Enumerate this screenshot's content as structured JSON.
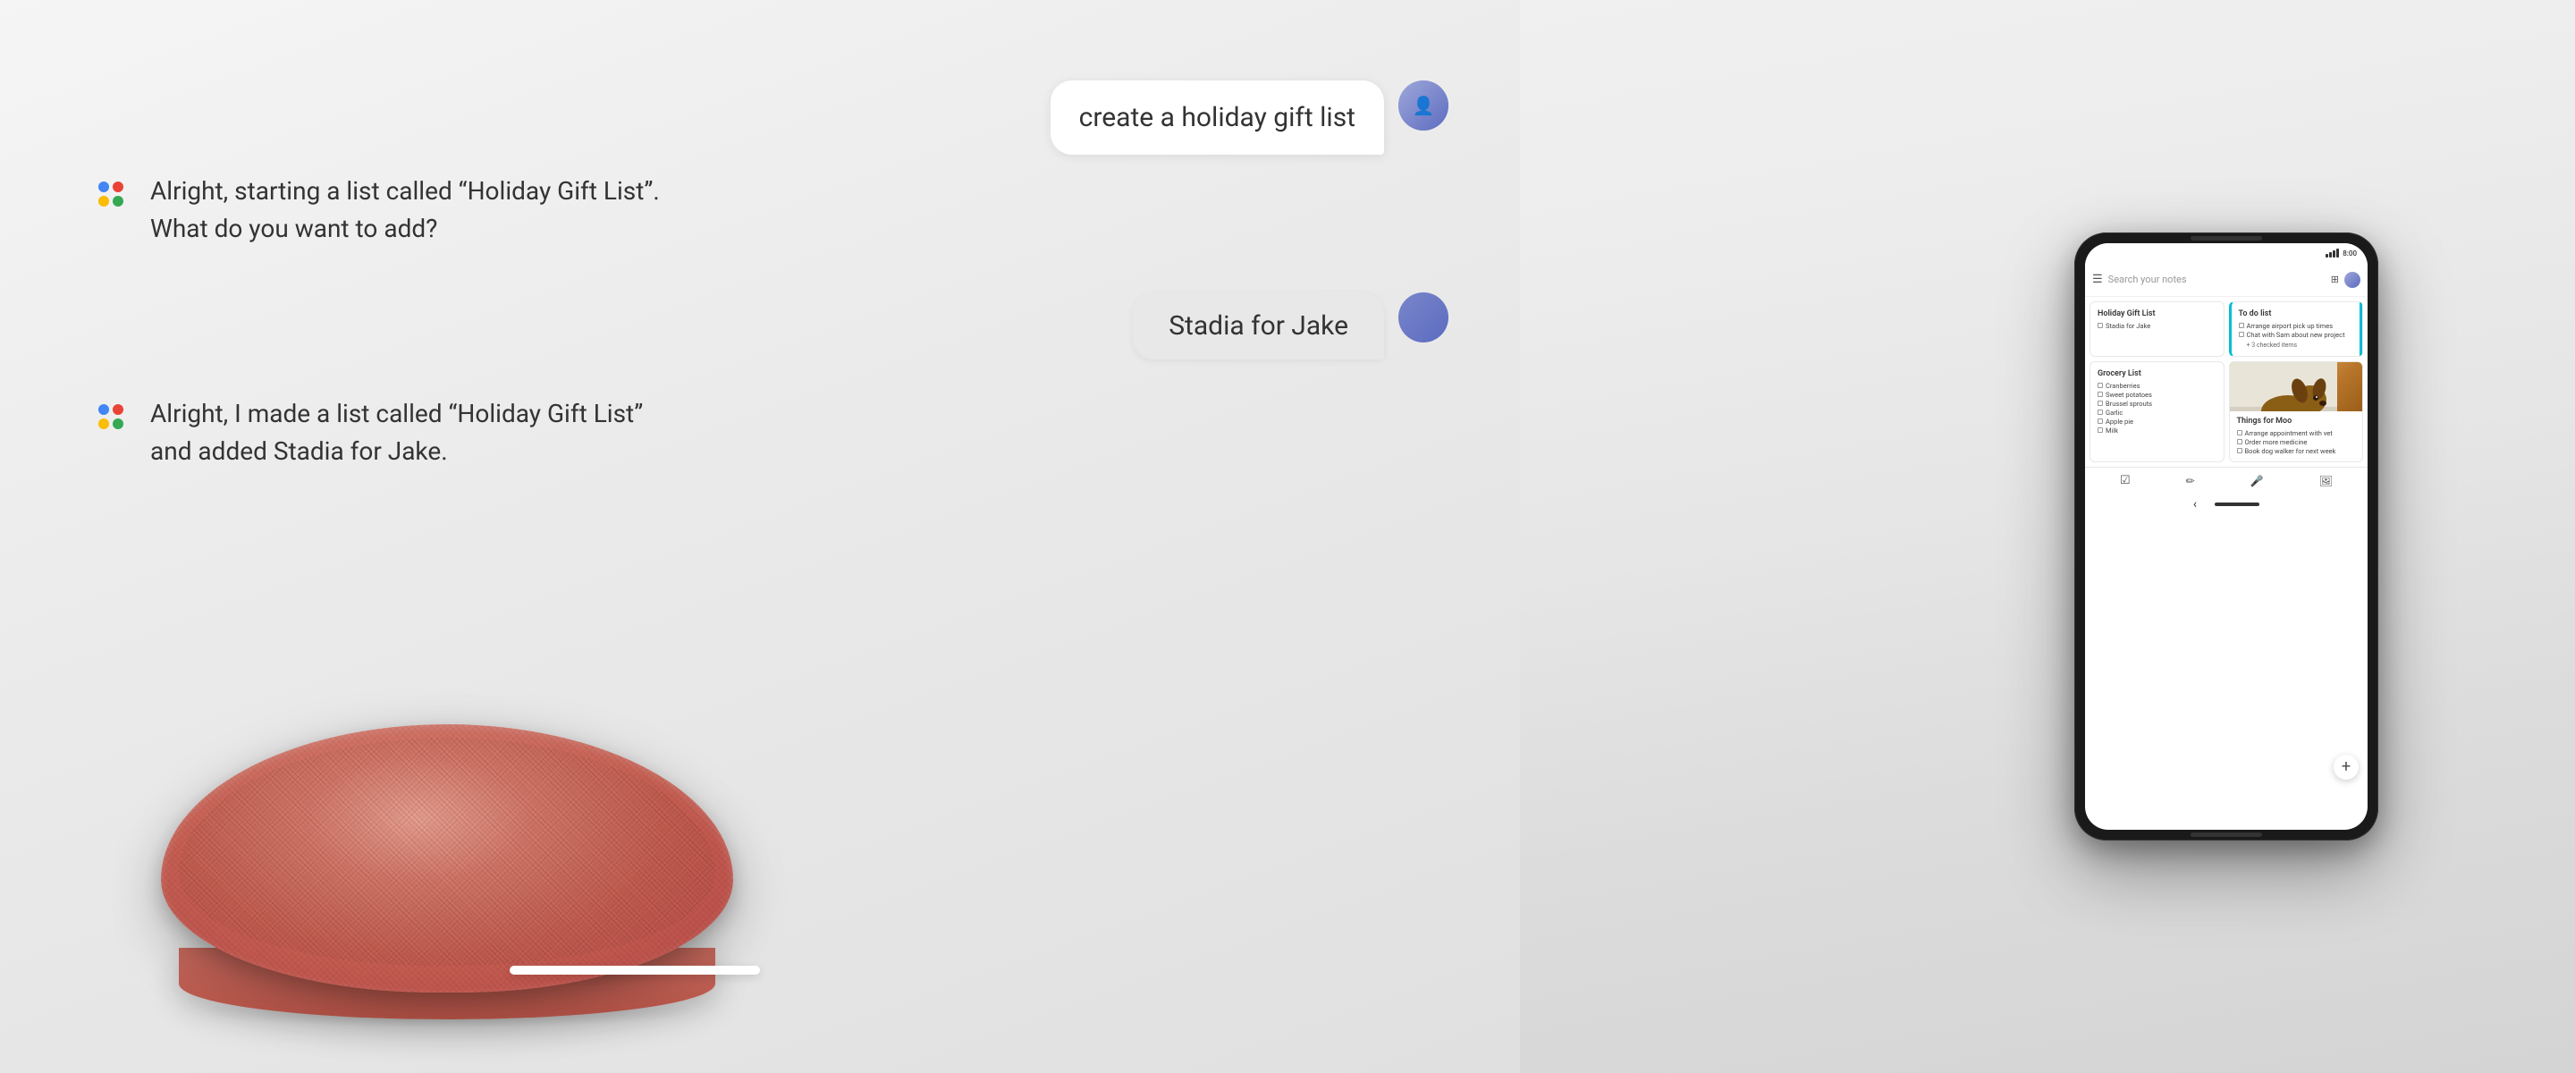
{
  "background": {
    "color": "#ebebeb"
  },
  "chat": {
    "user_message_1": "create a holiday gift list",
    "assistant_response_1": "Alright, starting a list called “Holiday Gift List”.\nWhat do you want to add?",
    "user_message_2": "Stadia for Jake",
    "assistant_response_2": "Alright, I made a list called “Holiday Gift List”\nand added Stadia for Jake."
  },
  "phone": {
    "status_bar": {
      "signal": "signal",
      "battery": "8:00"
    },
    "search_placeholder": "Search your notes",
    "notes": [
      {
        "id": "holiday-gift-list",
        "title": "Holiday Gift List",
        "items": [
          "Stadia for Jake"
        ],
        "type": "checklist"
      },
      {
        "id": "todo-list",
        "title": "To do list",
        "items": [
          "Arrange airport pick up times",
          "Chat with Sam about new project"
        ],
        "extra": "+ 3 checked items",
        "type": "todo-stripe"
      },
      {
        "id": "grocery-list",
        "title": "Grocery List",
        "items": [
          "Cranberries",
          "Sweet potatoes",
          "Brussel sprouts",
          "Garlic",
          "Apple pie",
          "Milk"
        ],
        "type": "checklist"
      },
      {
        "id": "things-for-moo",
        "title": "Things for Moo",
        "items": [
          "Arrange appointment with vet",
          "Order more medicine",
          "Book dog walker for next week"
        ],
        "type": "checklist-with-image",
        "has_image": true
      }
    ],
    "toolbar": {
      "icons": [
        "☑",
        "✏",
        "🎤",
        "🖼"
      ]
    },
    "fab_label": "+",
    "nav": {
      "back_label": "‹",
      "home_bar": "—"
    }
  },
  "speaker": {
    "color": "#d4756a",
    "alt": "Google Home Mini speaker in coral pink"
  },
  "google_assistant": {
    "dots": [
      "blue",
      "red",
      "yellow",
      "green"
    ]
  }
}
